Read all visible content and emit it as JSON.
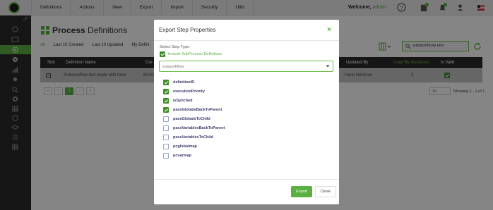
{
  "topbar": {
    "nav": [
      "Definitions",
      "Actions",
      "View",
      "Export",
      "Import",
      "Security",
      "Utils"
    ],
    "welcome_prefix": "Welcome,",
    "username": "admin",
    "icons": [
      "help-icon",
      "notes-icon",
      "notifications-icon",
      "user-settings-icon",
      "us-flag-icon"
    ]
  },
  "sidebar": {
    "icons": [
      "collapse-icon",
      "dashboard-icon",
      "inbox-icon",
      "definitions-icon",
      "run-icon",
      "reports-icon",
      "pin-icon",
      "search-icon",
      "settings-icon",
      "grid-icon",
      "help-icon",
      "layers-icon",
      "list-icon",
      "apps-icon"
    ]
  },
  "page": {
    "title_bold": "Process",
    "title_rest": "Definitions",
    "tabs": [
      "All",
      "Last 10 Created",
      "Last 10 Updated",
      "My Defini"
    ],
    "search_value": "subworkflow test"
  },
  "table": {
    "headers": {
      "sub": "Sub",
      "name": "Definition Name",
      "created": "Cre",
      "updated_by": "Updated By",
      "used_by": "Used By Instances",
      "is_valid": "Is Valid"
    },
    "row": {
      "name": "Subworkflow test made with false",
      "created": "6/10/2",
      "updated_by": "Hans Henkson",
      "used_by": "3"
    },
    "pager": {
      "first": "«",
      "prev": "‹",
      "current": "1",
      "next": "›",
      "last": "»",
      "per_page": "10",
      "showing": "Showing 1 - 1 of 1"
    }
  },
  "modal": {
    "title": "Export Step Properties",
    "close_glyph": "×",
    "select_label": "Select Step Type:",
    "include_label": "Include SubProcess Definitions",
    "include_checked": true,
    "select_value": "subworkflow",
    "options": [
      {
        "label": "definitionID",
        "checked": true
      },
      {
        "label": "executionPriority",
        "checked": true
      },
      {
        "label": "isSynched",
        "checked": true
      },
      {
        "label": "passGlobalsBackToParent",
        "checked": true
      },
      {
        "label": "passGlobalsToChild",
        "checked": false
      },
      {
        "label": "passVariablesBackToParent",
        "checked": false
      },
      {
        "label": "passVariablesToChild",
        "checked": false
      },
      {
        "label": "pcglobalmap",
        "checked": false
      },
      {
        "label": "pcvarmap",
        "checked": false
      }
    ],
    "export_label": "Export",
    "close_label": "Close"
  },
  "colors": {
    "accent": "#5ab142",
    "checkbox": "#3e8e2a",
    "sidebar": "#2b2b2b",
    "overlay": "rgba(0,0,0,0.48)"
  }
}
